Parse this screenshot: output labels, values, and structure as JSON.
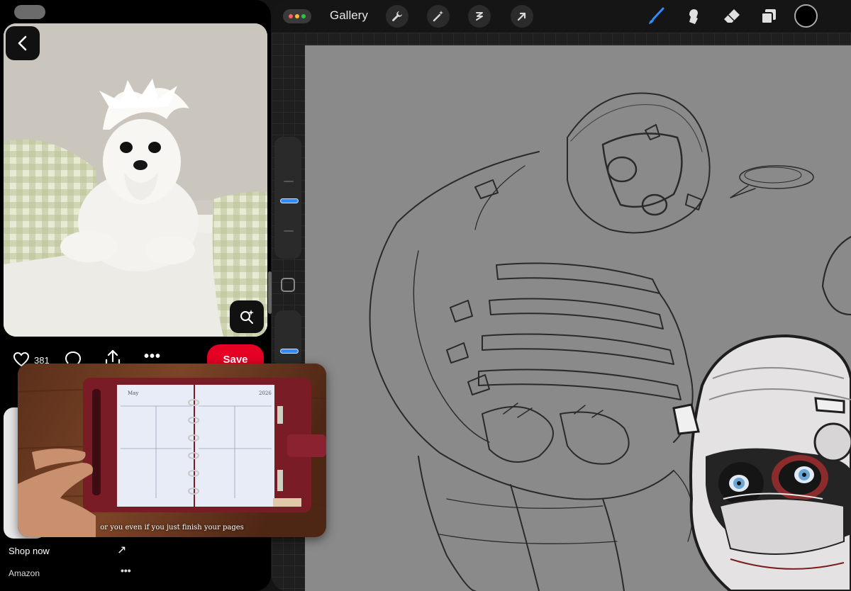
{
  "pinterest": {
    "like_count": "381",
    "save_label": "Save",
    "shop_label": "Shop now",
    "source_label": "Amazon",
    "more_label": "•••",
    "shop_arrow": "↗"
  },
  "pip_video": {
    "planner_month": "May",
    "planner_year": "2026",
    "caption": "or you even if you just finish your pages"
  },
  "procreate": {
    "gallery_label": "Gallery",
    "left_tools": [
      "wrench-icon",
      "magic-wand-icon",
      "selection-icon",
      "transform-arrow-icon"
    ],
    "right_tools": [
      "brush-icon",
      "smudge-icon",
      "eraser-icon",
      "layers-icon"
    ],
    "active_tool": "brush-icon",
    "current_color": "#000000",
    "accent_color": "#2f8cff"
  }
}
